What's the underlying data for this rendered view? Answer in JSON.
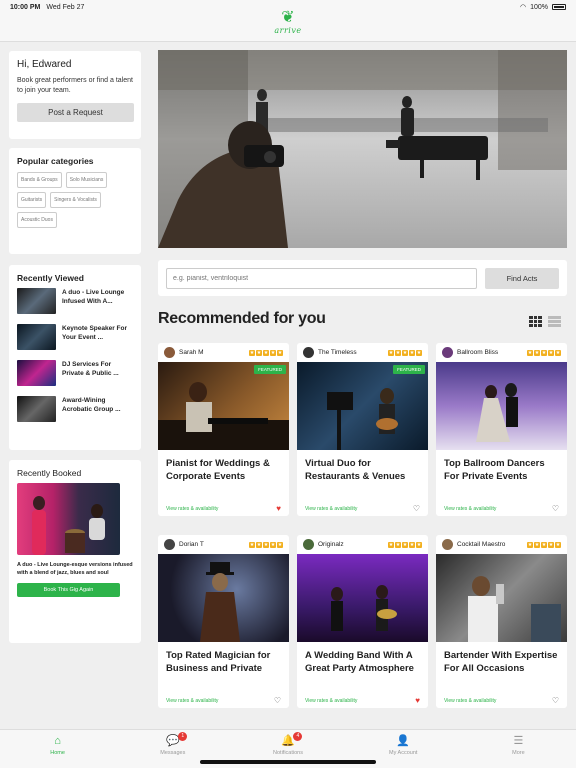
{
  "status": {
    "time": "10:00 PM",
    "date": "Wed Feb 27",
    "battery": "100%"
  },
  "brand": {
    "name": "arrive",
    "color": "#2db34a"
  },
  "greeting": {
    "title": "Hi, Edwared",
    "text": "Book great performers or find a talent to join your team.",
    "button": "Post a Request"
  },
  "categories": {
    "title": "Popular categories",
    "items": [
      "Bands & Groups",
      "Solo Musicians",
      "Guitarists",
      "Singers & Vocalists",
      "Acoustic Duos"
    ]
  },
  "recently_viewed": {
    "title": "Recently Viewed",
    "items": [
      "A duo - Live Lounge Infused With A...",
      "Keynote Speaker For Your Event ...",
      "DJ Services For Private & Public ...",
      "Award-Wining Acrobatic Group ..."
    ]
  },
  "recently_booked": {
    "title": "Recently Booked",
    "text": "A duo - Live Lounge-esque versions infused with a blend of jazz, blues and soul",
    "button": "Book This Gig Again"
  },
  "search": {
    "placeholder": "e.g. pianist, ventriloquist",
    "button": "Find Acts"
  },
  "recommended": {
    "title": "Recommended for you"
  },
  "acts": [
    {
      "name": "Sarah M",
      "featured": "FEATURED",
      "title": "Pianist for Weddings & Corporate Events",
      "link": "View rates & availability",
      "stars": 5,
      "favorited": true
    },
    {
      "name": "The Timeless",
      "featured": "FEATURED",
      "title": "Virtual Duo for Restaurants & Venues",
      "link": "View rates & availability",
      "stars": 5,
      "favorited": false
    },
    {
      "name": "Ballroom Bliss",
      "featured": "",
      "title": "Top Ballroom Dancers For Private Events",
      "link": "View rates & availability",
      "stars": 5,
      "favorited": false
    },
    {
      "name": "Dorian T",
      "featured": "",
      "title": "Top Rated Magician for Business and Private",
      "link": "View rates & availability",
      "stars": 5,
      "favorited": false
    },
    {
      "name": "Originalz",
      "featured": "",
      "title": "A Wedding Band With A Great Party Atmosphere",
      "link": "View rates & availability",
      "stars": 5,
      "favorited": true
    },
    {
      "name": "Cocktail Maestro",
      "featured": "",
      "title": "Bartender With Expertise For All Occasions",
      "link": "View rates & availability",
      "stars": 5,
      "favorited": false
    }
  ],
  "tabs": [
    {
      "label": "Home",
      "icon": "home-icon",
      "badge": ""
    },
    {
      "label": "Messages",
      "icon": "chat-icon",
      "badge": "1"
    },
    {
      "label": "Notifications",
      "icon": "bell-icon",
      "badge": "4"
    },
    {
      "label": "My Account",
      "icon": "person-icon",
      "badge": ""
    },
    {
      "label": "More",
      "icon": "menu-icon",
      "badge": ""
    }
  ]
}
